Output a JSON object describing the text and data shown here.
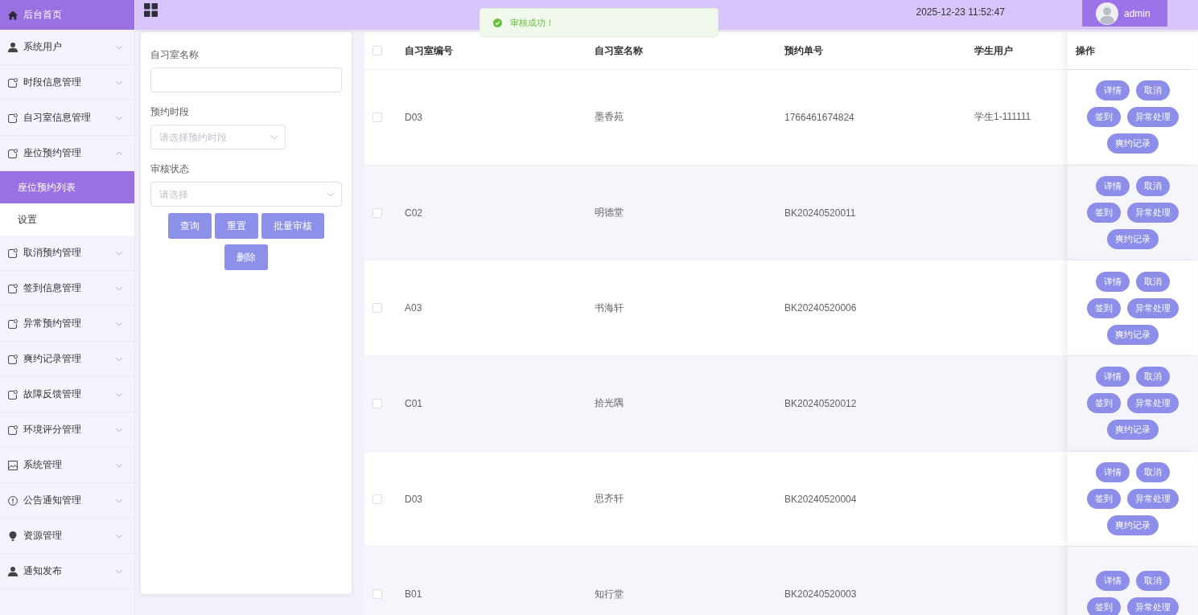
{
  "sidebar": {
    "items": [
      {
        "kind": "home",
        "label": "后台首页"
      },
      {
        "kind": "group",
        "label": "系统用户",
        "expanded": false
      },
      {
        "kind": "group",
        "label": "时段信息管理",
        "expanded": false
      },
      {
        "kind": "group",
        "label": "自习室信息管理",
        "expanded": false
      },
      {
        "kind": "group",
        "label": "座位预约管理",
        "expanded": true,
        "children": [
          {
            "label": "座位预约列表",
            "selected": true
          },
          {
            "label": "设置",
            "selected": false
          }
        ]
      },
      {
        "kind": "group",
        "label": "取消预约管理",
        "expanded": false
      },
      {
        "kind": "group",
        "label": "签到信息管理",
        "expanded": false
      },
      {
        "kind": "group",
        "label": "异常预约管理",
        "expanded": false
      },
      {
        "kind": "group",
        "label": "爽约记录管理",
        "expanded": false
      },
      {
        "kind": "group",
        "label": "故障反馈管理",
        "expanded": false
      },
      {
        "kind": "group",
        "label": "环境评分管理",
        "expanded": false
      },
      {
        "kind": "group",
        "label": "系统管理",
        "expanded": false
      },
      {
        "kind": "group",
        "label": "公告通知管理",
        "expanded": false
      },
      {
        "kind": "group",
        "label": "资源管理",
        "expanded": false
      },
      {
        "kind": "group",
        "label": "通知发布",
        "expanded": false
      }
    ]
  },
  "topbar": {
    "datetime": "2025-12-23 11:52:47",
    "user": "admin"
  },
  "toast": {
    "message": "审核成功！"
  },
  "filters": {
    "fields": [
      {
        "kind": "input",
        "label": "自习室名称"
      },
      {
        "kind": "picker",
        "label": "预约时段",
        "placeholder": "请选择预约时段"
      },
      {
        "kind": "select",
        "label": "审核状态",
        "placeholder": "请选择"
      }
    ],
    "buttons": [
      "查询",
      "重置",
      "批量审核",
      "删除"
    ]
  },
  "table": {
    "select_all": {
      "checked": false
    },
    "columns": [
      "自习室编号",
      "自习室名称",
      "预约单号",
      "学生用户",
      "操作"
    ],
    "rows": [
      {
        "checked": false,
        "room_no": "D03",
        "room_name": "墨香苑",
        "booking_no": "1766461674824",
        "student": "学生1-111111",
        "actions": [
          "详情",
          "取消",
          "签到",
          "异常处理",
          "爽约记录"
        ]
      },
      {
        "checked": false,
        "room_no": "C02",
        "room_name": "明德堂",
        "booking_no": "BK20240520011",
        "actions": [
          "详情",
          "取消",
          "签到",
          "异常处理",
          "爽约记录"
        ]
      },
      {
        "checked": false,
        "room_no": "A03",
        "room_name": "书海轩",
        "booking_no": "BK20240520006",
        "actions": [
          "详情",
          "取消",
          "签到",
          "异常处理",
          "爽约记录"
        ]
      },
      {
        "checked": false,
        "room_no": "C01",
        "room_name": "拾光隅",
        "booking_no": "BK20240520012",
        "actions": [
          "详情",
          "取消",
          "签到",
          "异常处理",
          "爽约记录"
        ]
      },
      {
        "checked": false,
        "room_no": "D03",
        "room_name": "思齐轩",
        "booking_no": "BK20240520004",
        "actions": [
          "详情",
          "取消",
          "签到",
          "异常处理",
          "爽约记录"
        ]
      },
      {
        "checked": false,
        "room_no": "B01",
        "room_name": "知行堂",
        "booking_no": "BK20240520003",
        "actions": [
          "详情",
          "取消",
          "签到",
          "异常处理"
        ]
      }
    ]
  }
}
